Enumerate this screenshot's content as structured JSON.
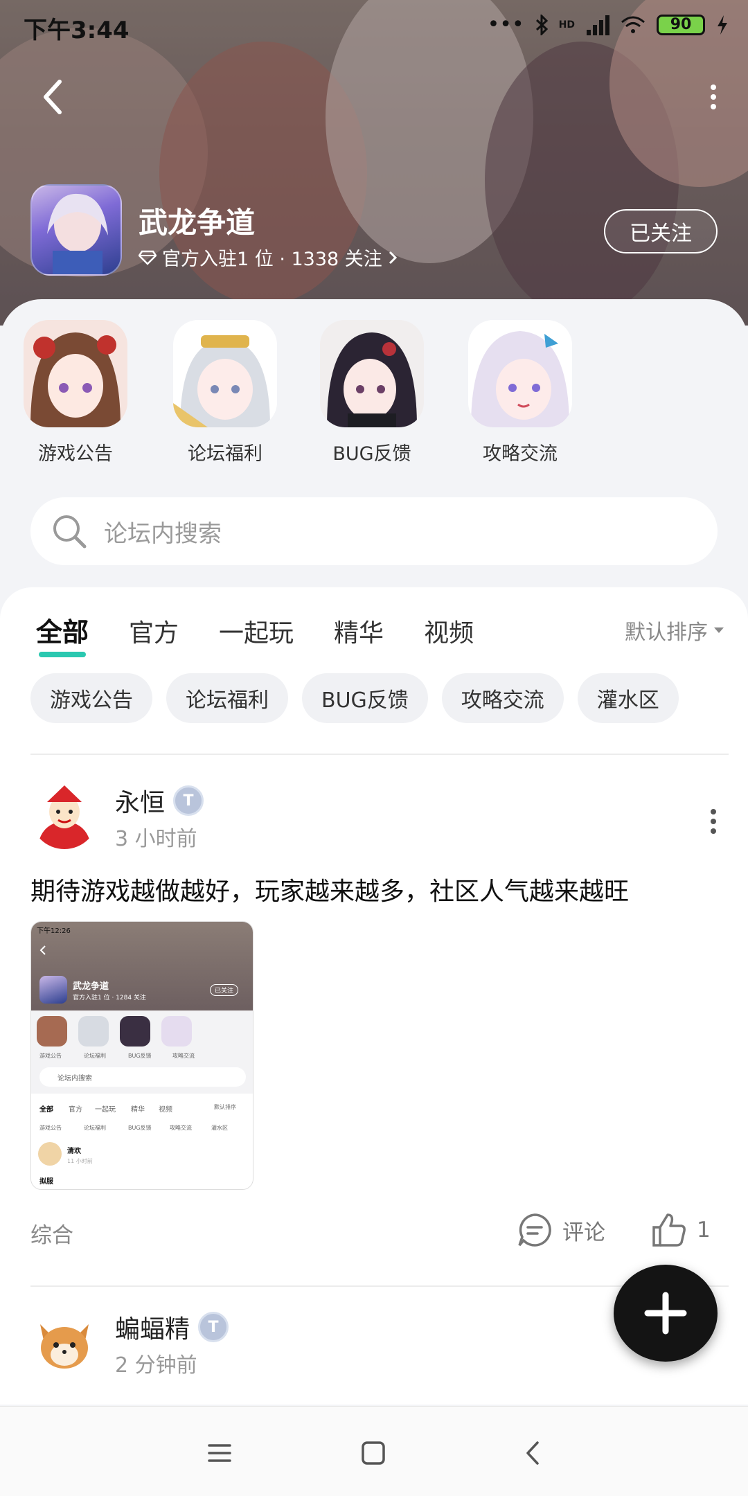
{
  "status": {
    "time": "下午3:44",
    "battery": "90",
    "network": "HD"
  },
  "header": {
    "game_name": "武龙争道",
    "meta": "官方入驻1 位 · 1338 关注",
    "follow_label": "已关注"
  },
  "channels": [
    {
      "label": "游戏公告"
    },
    {
      "label": "论坛福利"
    },
    {
      "label": "BUG反馈"
    },
    {
      "label": "攻略交流"
    }
  ],
  "search": {
    "placeholder": "论坛内搜索"
  },
  "tabs": [
    {
      "label": "全部"
    },
    {
      "label": "官方"
    },
    {
      "label": "一起玩"
    },
    {
      "label": "精华"
    },
    {
      "label": "视频"
    }
  ],
  "sort_label": "默认排序",
  "chips": [
    {
      "label": "游戏公告"
    },
    {
      "label": "论坛福利"
    },
    {
      "label": "BUG反馈"
    },
    {
      "label": "攻略交流"
    },
    {
      "label": "灌水区"
    }
  ],
  "posts": [
    {
      "username": "永恒",
      "time": "3 小时前",
      "text": "期待游戏越做越好，玩家越来越多，社区人气越来越旺",
      "category": "综合",
      "comment_label": "评论",
      "likes": "1",
      "screenshot": {
        "time": "下午12:26",
        "game_name": "武龙争道",
        "meta": "官方入驻1 位 · 1284 关注",
        "follow_label": "已关注",
        "channels": [
          "游戏公告",
          "论坛福利",
          "BUG反馈",
          "攻略交流"
        ],
        "search": "论坛内搜索",
        "tabs": [
          "全部",
          "官方",
          "一起玩",
          "精华",
          "视频"
        ],
        "sort": "默认排序",
        "chips": [
          "游戏公告",
          "论坛福利",
          "BUG反馈",
          "攻略交流",
          "灌水区"
        ],
        "user": "清欢",
        "user_time": "11 小时前",
        "snippet": "拟服"
      }
    },
    {
      "username": "蝙蝠精",
      "time": "2 分钟前"
    }
  ],
  "colors": {
    "accent": "#2ac8b0",
    "background": "#f3f4f7"
  }
}
